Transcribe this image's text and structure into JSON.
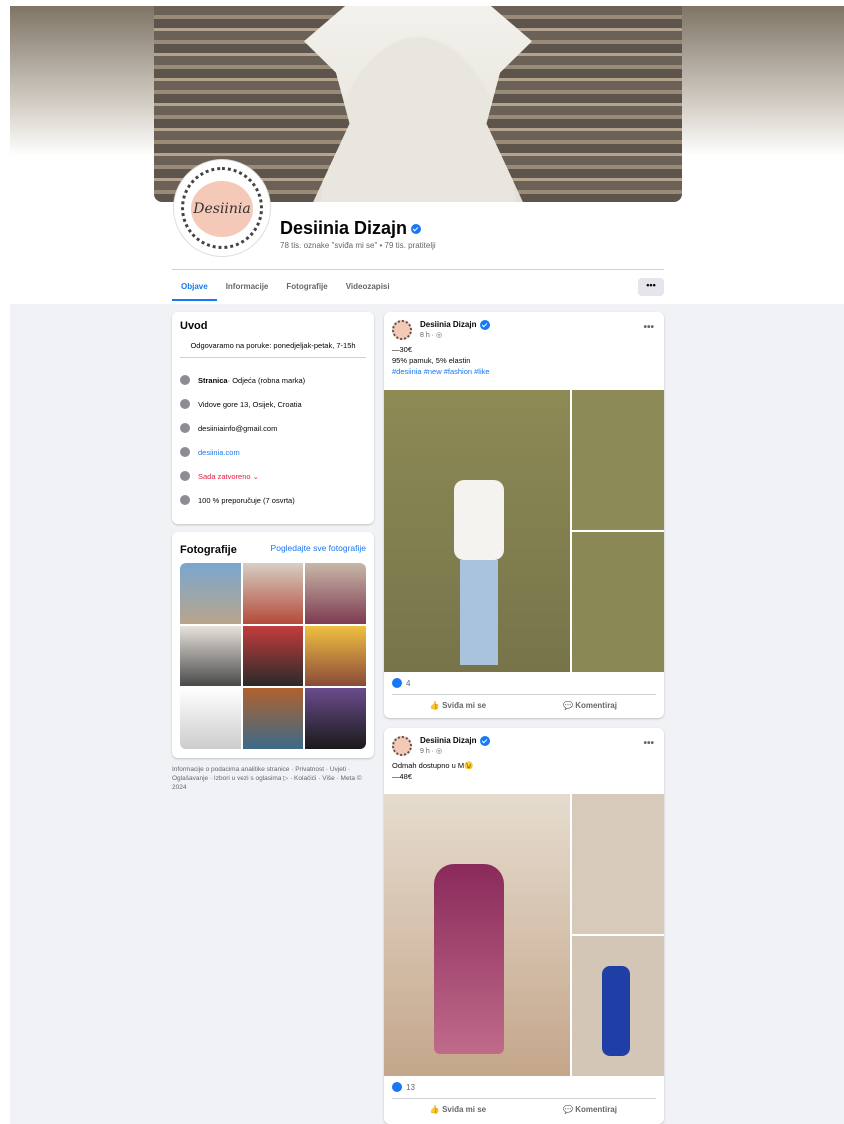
{
  "page": {
    "name": "Desiinia Dizajn",
    "avatar_text": "Desiinia",
    "stats": "78 tis. oznake \"sviđa mi se\" • 79 tis. pratitelji"
  },
  "tabs": [
    "Objave",
    "Informacije",
    "Fotografije",
    "Videozapisi"
  ],
  "more_label": "•••",
  "intro": {
    "title": "Uvod",
    "bio": "Odgovaramo na poruke: ponedjeljak-petak, 7-15h",
    "rows": [
      {
        "icon": "info-icon",
        "bold": "Stranica",
        "text": " · Odjeća (robna marka)"
      },
      {
        "icon": "location-icon",
        "bold": "",
        "text": "Vidove gore 13, Osijek, Croatia"
      },
      {
        "icon": "email-icon",
        "bold": "",
        "text": "desiiniainfo@gmail.com"
      },
      {
        "icon": "globe-icon",
        "bold": "",
        "text": "desiinia.com"
      },
      {
        "icon": "clock-icon",
        "bold": "",
        "text": "Sada zatvoreno ⌄"
      },
      {
        "icon": "star-icon",
        "bold": "",
        "text": "100 % preporučuje (7 osvrta)"
      }
    ]
  },
  "photos": {
    "title": "Fotografije",
    "link": "Pogledajte sve fotografije"
  },
  "footer": "Informacije o podacima analitike stranice · Privatnost · Uvjeti · Oglašavanje · Izbori u vezi s oglasima ▷ · Kolačići · Više · Meta © 2024",
  "posts": [
    {
      "author": "Desiinia Dizajn",
      "time": "8 h · ◎",
      "price": "—30€",
      "line2": "95% pamuk, 5% elastin",
      "tags": "#desiinia #new #fashion #like",
      "reactions": "4",
      "like": "Sviđa mi se",
      "comment": "Komentiraj"
    },
    {
      "author": "Desiinia Dizajn",
      "time": "9 h · ◎",
      "price": "Odmah dostupno u M😉",
      "line2": "—48€",
      "tags": "",
      "reactions": "13",
      "like": "Sviđa mi se",
      "comment": "Komentiraj"
    }
  ],
  "colors": {
    "accent": "#1877f2",
    "closed": "#e41e3f",
    "bg": "#f0f2f5"
  }
}
